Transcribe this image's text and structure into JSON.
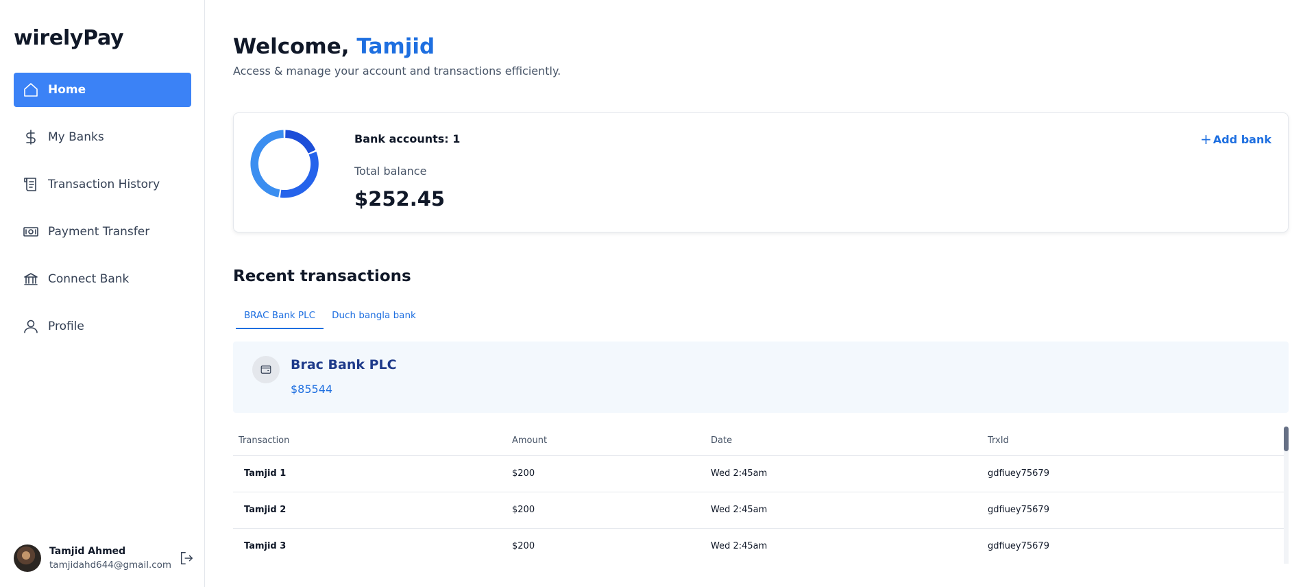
{
  "app": {
    "logo": "wirelyPay"
  },
  "sidebar": {
    "items": [
      {
        "label": "Home",
        "icon": "home-icon",
        "active": true
      },
      {
        "label": "My Banks",
        "icon": "dollar-icon"
      },
      {
        "label": "Transaction History",
        "icon": "receipt-icon"
      },
      {
        "label": "Payment Transfer",
        "icon": "money-icon"
      },
      {
        "label": "Connect Bank",
        "icon": "bank-icon"
      },
      {
        "label": "Profile",
        "icon": "user-icon"
      }
    ]
  },
  "user": {
    "name": "Tamjid Ahmed",
    "email": "tamjidahd644@gmail.com"
  },
  "header": {
    "welcome": "Welcome,",
    "user_first_name": "Tamjid",
    "subtitle": "Access & manage your account and transactions efficiently."
  },
  "balance": {
    "bank_accounts_text": "Bank accounts: 1",
    "total_label": "Total balance",
    "total_amount": "$252.45",
    "add_bank_label": "Add bank",
    "colors": {
      "dark": "#1d4ed8",
      "medium": "#2563eb",
      "light": "#3b8ef0"
    }
  },
  "recent": {
    "title": "Recent transactions",
    "tabs": [
      "BRAC Bank PLC",
      "Duch bangla bank"
    ],
    "active_tab": 0,
    "bank": {
      "name": "Brac Bank PLC",
      "amount": "$85544"
    },
    "columns": [
      "Transaction",
      "Amount",
      "Date",
      "TrxId"
    ],
    "rows": [
      [
        "Tamjid 1",
        "$200",
        "Wed 2:45am",
        "gdfiuey75679"
      ],
      [
        "Tamjid 2",
        "$200",
        "Wed 2:45am",
        "gdfiuey75679"
      ],
      [
        "Tamjid 3",
        "$200",
        "Wed 2:45am",
        "gdfiuey75679"
      ]
    ]
  }
}
